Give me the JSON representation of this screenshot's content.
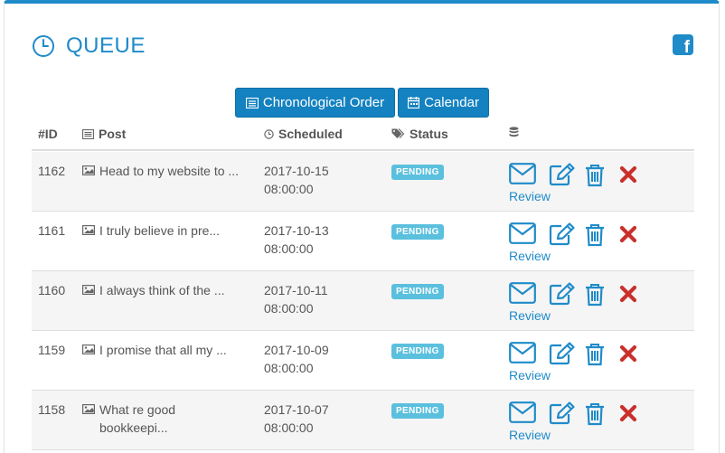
{
  "header": {
    "title": "QUEUE"
  },
  "buttons": {
    "chronological": "Chronological Order",
    "calendar": "Calendar"
  },
  "columns": {
    "id": "#ID",
    "post": "Post",
    "scheduled": "Scheduled",
    "status": "Status"
  },
  "rows": [
    {
      "id": "1162",
      "post": "Head to my website to ...",
      "date": "2017-10-15",
      "time": "08:00:00",
      "status": "PENDING",
      "review": "Review"
    },
    {
      "id": "1161",
      "post": "I truly believe in pre...",
      "date": "2017-10-13",
      "time": "08:00:00",
      "status": "PENDING",
      "review": "Review"
    },
    {
      "id": "1160",
      "post": "I always think of the ...",
      "date": "2017-10-11",
      "time": "08:00:00",
      "status": "PENDING",
      "review": "Review"
    },
    {
      "id": "1159",
      "post": "I promise that all my ...",
      "date": "2017-10-09",
      "time": "08:00:00",
      "status": "PENDING",
      "review": "Review"
    },
    {
      "id": "1158",
      "post": "What re good bookkeepi...",
      "date": "2017-10-07",
      "time": "08:00:00",
      "status": "PENDING",
      "review": "Review"
    }
  ],
  "colors": {
    "accent": "#1f8bc9",
    "button": "#1482c0",
    "badge": "#5bc0de",
    "delete": "#c9302c"
  },
  "icons": [
    "clock-icon",
    "facebook-icon",
    "list-icon",
    "calendar-icon",
    "image-icon",
    "database-icon",
    "tag-icon",
    "envelope-icon",
    "edit-icon",
    "trash-icon",
    "delete-icon"
  ]
}
